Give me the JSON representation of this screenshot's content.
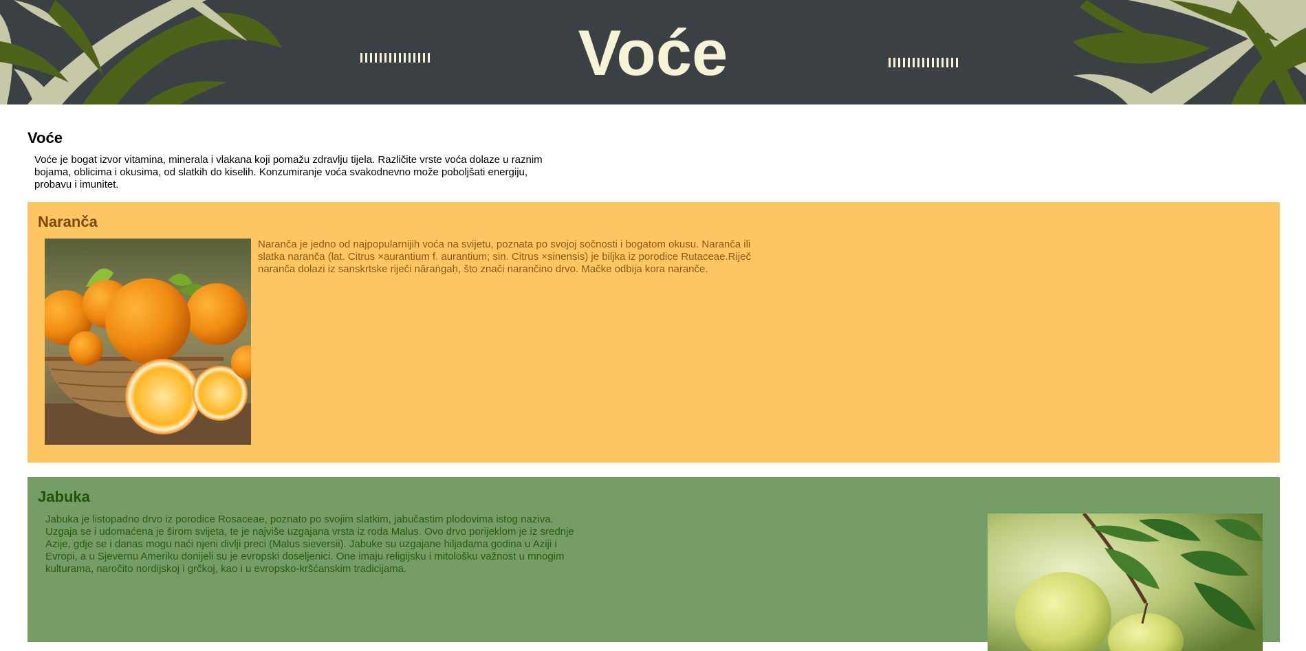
{
  "banner": {
    "title": "Voće",
    "colors": {
      "background": "#3b4044",
      "title": "#f7f3d7",
      "leaf_dark": "#4f6318",
      "leaf_light": "#c7c8a7"
    }
  },
  "intro": {
    "heading": "Voće",
    "text": "Voće je bogat izvor vitamina, minerala i vlakana koji pomažu zdravlju tijela. Različite vrste voća dolaze u raznim bojama, oblicima i okusima, od slatkih do kiselih. Konzumiranje voća svakodnevno može poboljšati energiju, probavu i imunitet."
  },
  "fruits": [
    {
      "name": "Naranča",
      "image": "orange-basket-photo",
      "text": "Naranča je jedno od najpopularnijih voća na svijetu, poznata po svojoj sočnosti i bogatom okusu. Naranča ili slatka naranča (lat. Citrus ×aurantium f. aurantium; sin. Citrus ×sinensis) je biljka iz porodice Rutaceae.Riječ naranča dolazi iz sanskrtske riječi nāraṅgaḥ, što znači narančino drvo. Mačke odbija kora naranče.",
      "colors": {
        "background": "#fec563",
        "heading": "#7a4a0a",
        "text": "#8a5a14"
      }
    },
    {
      "name": "Jabuka",
      "image": "green-apples-photo",
      "text": "Jabuka je listopadno drvo iz porodice Rosaceae, poznato po svojim slatkim, jabučastim plodovima istog naziva. Uzgaja se i udomaćena je širom svijeta, te je najviše uzgajana vrsta iz roda Malus. Ovo drvo porijeklom je iz srednje Azije, gdje se i danas mogu naći njeni divlji preci (Malus sieversii). Jabuke su uzgajane hiljadama godina u Aziji i Evropi, a u Sjevernu Ameriku donijeli su je evropski doseljenici. One imaju religijsku i mitološku važnost u mnogim kulturama, naročito nordijskoj i grčkoj, kao i u evropsko-kršćanskim tradicijama.",
      "colors": {
        "background": "#779d66",
        "heading": "#1f5208",
        "text": "#2b5a10"
      }
    }
  ]
}
